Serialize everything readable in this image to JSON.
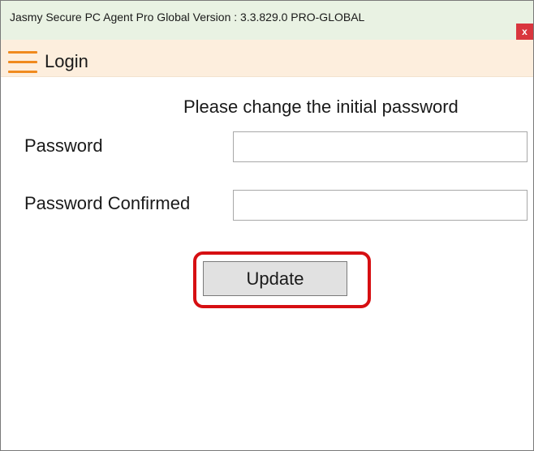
{
  "window": {
    "title": "Jasmy Secure PC Agent Pro Global Version : 3.3.829.0 PRO-GLOBAL",
    "close_label": "x"
  },
  "menu": {
    "icon": "hamburger-menu-icon",
    "title": "Login"
  },
  "form": {
    "instruction": "Please change the initial password",
    "password_label": "Password",
    "password_value": "",
    "confirm_label": "Password Confirmed",
    "confirm_value": "",
    "update_label": "Update"
  },
  "colors": {
    "menubar_bg": "#fdeedd",
    "hamburger": "#f08a1e",
    "close_button": "#d9363e",
    "highlight": "#d60f12"
  }
}
